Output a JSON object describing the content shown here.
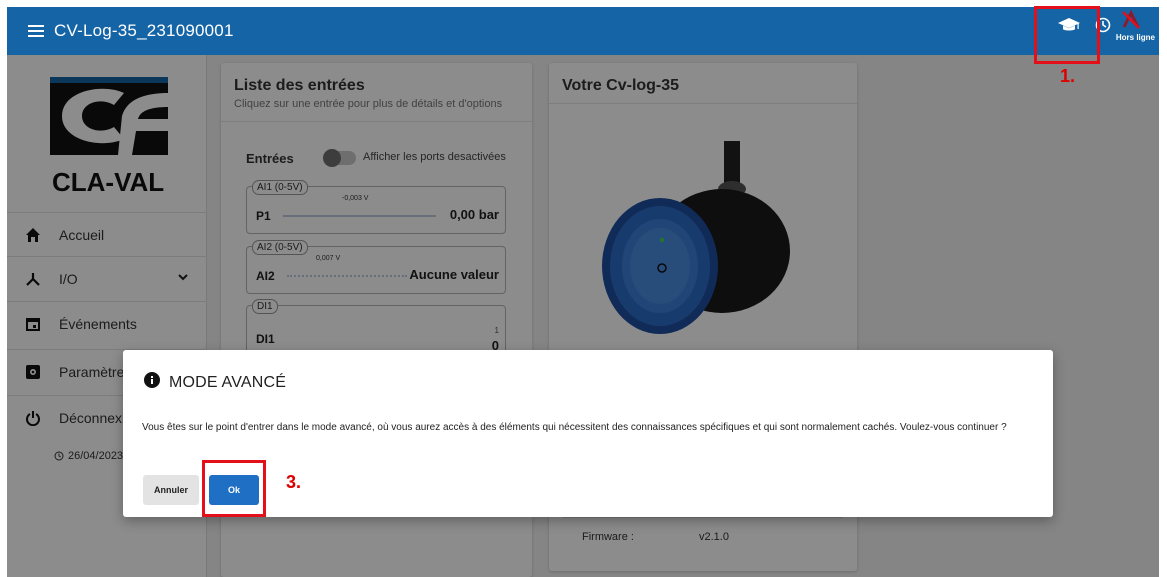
{
  "app": {
    "title": "CV-Log-35_231090001",
    "offline_label": "Hors ligne",
    "colors": {
      "topbar": "#1565a6",
      "accent": "#1f6fc4",
      "highlight": "#e3101a"
    }
  },
  "sidebar": {
    "logo_text": "CLA-VAL",
    "items": [
      {
        "label": "Accueil",
        "icon": "home-icon"
      },
      {
        "label": "I/O",
        "icon": "io-icon"
      },
      {
        "label": "Événements",
        "icon": "calendar-icon"
      },
      {
        "label": "Paramètres",
        "icon": "settings-icon"
      },
      {
        "label": "Déconnexio",
        "icon": "power-icon"
      }
    ],
    "date": "26/04/2023"
  },
  "entries_card": {
    "title": "Liste des entrées",
    "subtitle": "Cliquez sur une entrée pour plus de détails et d'options",
    "section_label": "Entrées",
    "toggle_label": "Afficher les ports desactivées",
    "entries": [
      {
        "chip": "AI1 (0-5V)",
        "name": "P1",
        "voltage": "-0,003 V",
        "value": "0,00 bar"
      },
      {
        "chip": "AI2 (0-5V)",
        "name": "AI2",
        "voltage": "0,007 V",
        "value": "Aucune valeur"
      },
      {
        "chip": "DI1",
        "name": "DI1",
        "small": "1",
        "value": "0"
      }
    ]
  },
  "device_card": {
    "title": "Votre Cv-log-35",
    "firmware_label": "Firmware :",
    "firmware_value": "v2.1.0"
  },
  "dialog": {
    "title": "MODE AVANCÉ",
    "text": "Vous êtes sur le point d'entrer dans le mode avancé, où vous aurez accès à des éléments qui nécessitent des connaissances spécifiques et qui sont normalement cachés. Voulez-vous continuer ?",
    "cancel_label": "Annuler",
    "ok_label": "Ok"
  },
  "annotations": {
    "step1": "1.",
    "step3": "3."
  }
}
